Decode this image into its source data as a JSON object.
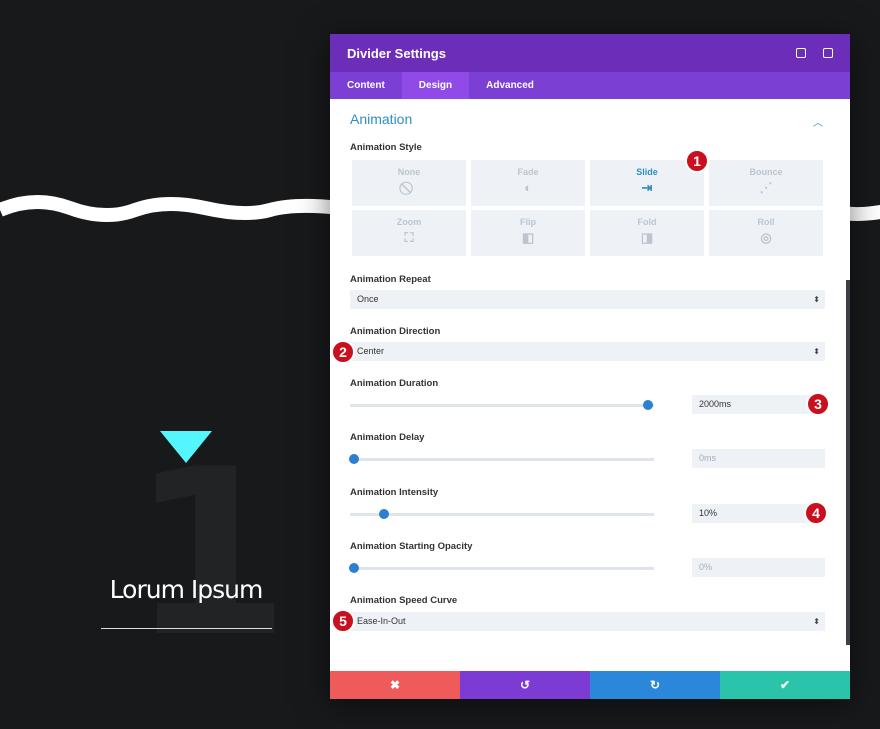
{
  "background": {
    "heading": "Lorum Ipsum",
    "number": "1",
    "accent": "#55f5fd"
  },
  "modal": {
    "title": "Divider Settings",
    "tabs": [
      {
        "label": "Content"
      },
      {
        "label": "Design"
      },
      {
        "label": "Advanced"
      }
    ],
    "active_tab": "Design",
    "section": "Animation",
    "style_label": "Animation Style",
    "styles": [
      {
        "label": "None",
        "icon": "⃠"
      },
      {
        "label": "Fade",
        "icon": "◐"
      },
      {
        "label": "Slide",
        "icon": "⇥"
      },
      {
        "label": "Bounce",
        "icon": "⋰"
      },
      {
        "label": "Zoom",
        "icon": "⛶"
      },
      {
        "label": "Flip",
        "icon": "◧"
      },
      {
        "label": "Fold",
        "icon": "◨"
      },
      {
        "label": "Roll",
        "icon": "◎"
      }
    ],
    "selected_style": "Slide",
    "repeat": {
      "label": "Animation Repeat",
      "value": "Once"
    },
    "direction": {
      "label": "Animation Direction",
      "value": "Center"
    },
    "duration": {
      "label": "Animation Duration",
      "value": "2000ms",
      "fraction": 0.98
    },
    "delay": {
      "label": "Animation Delay",
      "value": "0ms",
      "fraction": 0
    },
    "intensity": {
      "label": "Animation Intensity",
      "value": "10%",
      "fraction": 0.1
    },
    "opacity": {
      "label": "Animation Starting Opacity",
      "value": "0%",
      "fraction": 0
    },
    "curve": {
      "label": "Animation Speed Curve",
      "value": "Ease-In-Out"
    },
    "footer": {
      "cancel": "✖",
      "undo": "↺",
      "redo": "↻",
      "save": "✔"
    },
    "colors": {
      "header": "#6c2eb9",
      "tabs": "#7b3fd4",
      "cancel": "#ef5a5a",
      "undo": "#7c3cd4",
      "redo": "#2b87da",
      "save": "#29c4a9"
    }
  },
  "badges": [
    "1",
    "2",
    "3",
    "4",
    "5"
  ]
}
